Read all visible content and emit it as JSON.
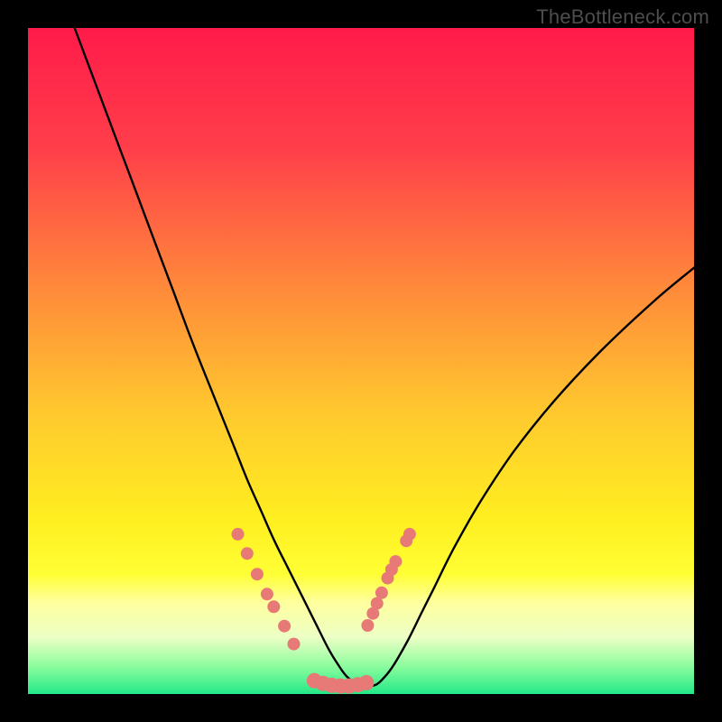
{
  "attribution": "TheBottleneck.com",
  "colors": {
    "frame": "#000000",
    "attribution": "#4d4d4d",
    "curve": "#000000",
    "dot_fill": "#e77a76",
    "gradient_stops": [
      {
        "offset": 0.0,
        "color": "#ff1b4a"
      },
      {
        "offset": 0.18,
        "color": "#ff3e4a"
      },
      {
        "offset": 0.4,
        "color": "#ff8d3a"
      },
      {
        "offset": 0.58,
        "color": "#ffc92e"
      },
      {
        "offset": 0.74,
        "color": "#ffef20"
      },
      {
        "offset": 0.82,
        "color": "#ffff35"
      },
      {
        "offset": 0.862,
        "color": "#ffff9e"
      },
      {
        "offset": 0.915,
        "color": "#ecffc5"
      },
      {
        "offset": 0.958,
        "color": "#8dfd9e"
      },
      {
        "offset": 1.0,
        "color": "#23e887"
      }
    ]
  },
  "chart_data": {
    "type": "line",
    "title": "",
    "xlabel": "",
    "ylabel": "",
    "xlim": [
      0,
      100
    ],
    "ylim": [
      0,
      100
    ],
    "series": [
      {
        "name": "bottleneck-curve",
        "x": [
          7,
          10,
          13,
          16,
          19,
          22,
          25,
          28,
          31,
          33,
          35,
          37,
          39,
          41,
          43,
          45,
          46.5,
          48,
          50,
          52,
          53.5,
          55,
          57,
          59,
          61,
          64,
          68,
          73,
          79,
          86,
          94,
          100
        ],
        "y": [
          100,
          92,
          84,
          76,
          68,
          60,
          52,
          44.5,
          37,
          32,
          27.5,
          23,
          19,
          15,
          11,
          7,
          4.5,
          2.5,
          1.3,
          1.3,
          2.5,
          4.5,
          8,
          12,
          16,
          22,
          29,
          36.5,
          44,
          51.5,
          59,
          64
        ]
      }
    ],
    "dots_left": [
      {
        "x": 31.5,
        "y": 24.0
      },
      {
        "x": 32.9,
        "y": 21.1
      },
      {
        "x": 34.4,
        "y": 18.0
      },
      {
        "x": 35.9,
        "y": 15.0
      },
      {
        "x": 36.9,
        "y": 13.1
      },
      {
        "x": 38.5,
        "y": 10.2
      },
      {
        "x": 39.9,
        "y": 7.5
      }
    ],
    "dots_right": [
      {
        "x": 56.8,
        "y": 23.0
      },
      {
        "x": 57.3,
        "y": 24.0
      },
      {
        "x": 55.2,
        "y": 19.9
      },
      {
        "x": 54.6,
        "y": 18.7
      },
      {
        "x": 54.0,
        "y": 17.4
      },
      {
        "x": 53.1,
        "y": 15.2
      },
      {
        "x": 52.4,
        "y": 13.6
      },
      {
        "x": 51.8,
        "y": 12.1
      },
      {
        "x": 51.0,
        "y": 10.3
      }
    ],
    "dots_bottom": [
      {
        "x": 43.0,
        "y": 2.0
      },
      {
        "x": 44.3,
        "y": 1.6
      },
      {
        "x": 45.6,
        "y": 1.3
      },
      {
        "x": 46.9,
        "y": 1.2
      },
      {
        "x": 48.2,
        "y": 1.2
      },
      {
        "x": 49.5,
        "y": 1.4
      },
      {
        "x": 50.8,
        "y": 1.7
      }
    ]
  }
}
